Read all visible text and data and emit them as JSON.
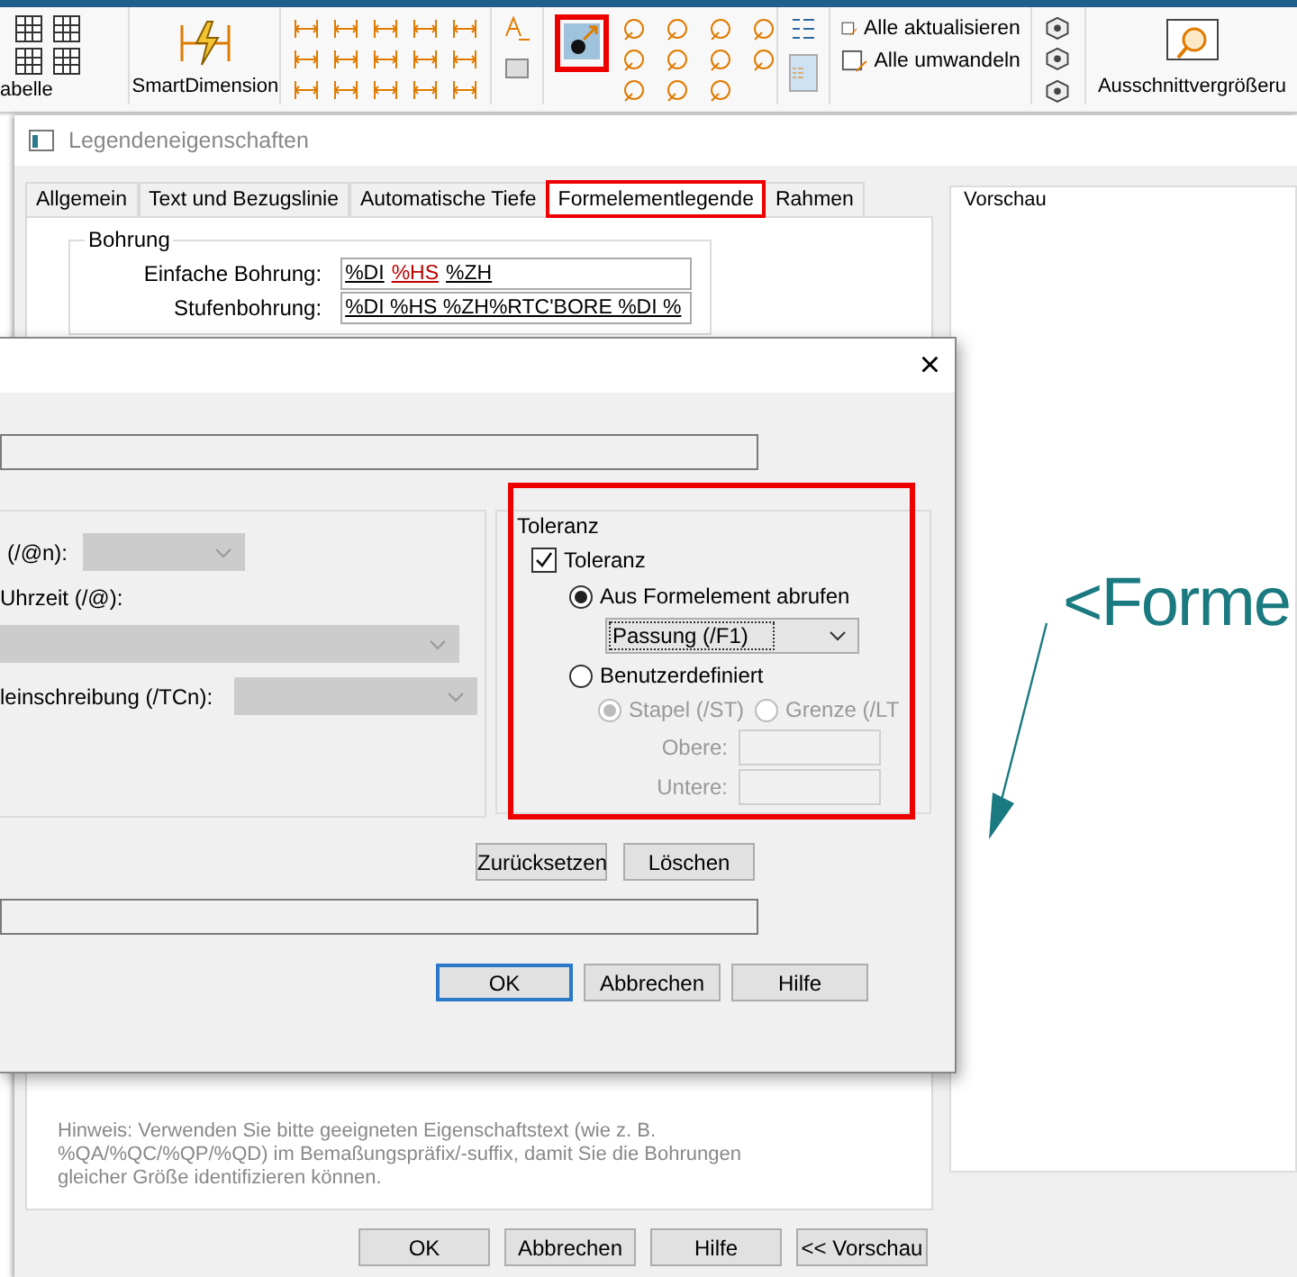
{
  "ribbon": {
    "table_label": "abelle",
    "smart_dimension": "SmartDimension",
    "actions": [
      {
        "label": "Alle aktualisieren"
      },
      {
        "label": "Alle umwandeln"
      }
    ],
    "zoom_label": "Ausschnittvergrößeru"
  },
  "properties_dialog": {
    "title": "Legendeneigenschaften",
    "tabs": [
      {
        "label": "Allgemein",
        "selected": false
      },
      {
        "label": "Text und Bezugslinie",
        "selected": false
      },
      {
        "label": "Automatische Tiefe",
        "selected": false
      },
      {
        "label": "Formelementlegende",
        "selected": true
      },
      {
        "label": "Rahmen",
        "selected": false
      }
    ],
    "group_title": "Bohrung",
    "fields": [
      {
        "label": "Einfache Bohrung:",
        "tokens": [
          {
            "text": "%DI",
            "color": "#000000"
          },
          {
            "text": "%HS",
            "color": "#c00000"
          },
          {
            "text": "%ZH",
            "color": "#000000"
          }
        ]
      },
      {
        "label": "Stufenbohrung:",
        "tokens": [
          {
            "text": "%DI %HS %ZH%RTC'BORE %DI %",
            "color": "#000000"
          }
        ]
      }
    ],
    "hint": "Hinweis: Verwenden Sie bitte geeigneten Eigenschaftstext (wie z. B.\n%QA/%QC/%QP/%QD) im Bemaßungspräfix/-suffix, damit Sie die Bohrungen\ngleicher Größe identifizieren können.",
    "preview_label": "Vorschau",
    "preview_text": "<Forme",
    "buttons": [
      "OK",
      "Abbrechen",
      "Hilfe",
      "<< Vorschau"
    ]
  },
  "tolerance_dialog": {
    "close": "×",
    "left_fields": [
      {
        "label": "(/@n):",
        "disabled": true
      },
      {
        "label": "Uhrzeit (/@):",
        "disabled": true
      },
      {
        "label": "leinschreibung (/TCn):",
        "disabled": true
      }
    ],
    "tolerance": {
      "title": "Toleranz",
      "checkbox": {
        "label": "Toleranz",
        "checked": true
      },
      "options": [
        {
          "label": "Aus Formelement abrufen",
          "selected": true
        },
        {
          "label": "Benutzerdefiniert",
          "selected": false
        }
      ],
      "dropdown": "Passung (/F1)",
      "sub_options": [
        {
          "label": "Stapel (/ST)",
          "selected": true,
          "disabled": true
        },
        {
          "label": "Grenze (/LT",
          "selected": false,
          "disabled": true
        }
      ],
      "limits": [
        {
          "label": "Obere:",
          "disabled": true
        },
        {
          "label": "Untere:",
          "disabled": true
        }
      ]
    },
    "actions": [
      "Zurücksetzen",
      "Löschen"
    ],
    "buttons": [
      {
        "label": "OK",
        "default": true
      },
      {
        "label": "Abbrechen",
        "default": false
      },
      {
        "label": "Hilfe",
        "default": false
      }
    ]
  }
}
